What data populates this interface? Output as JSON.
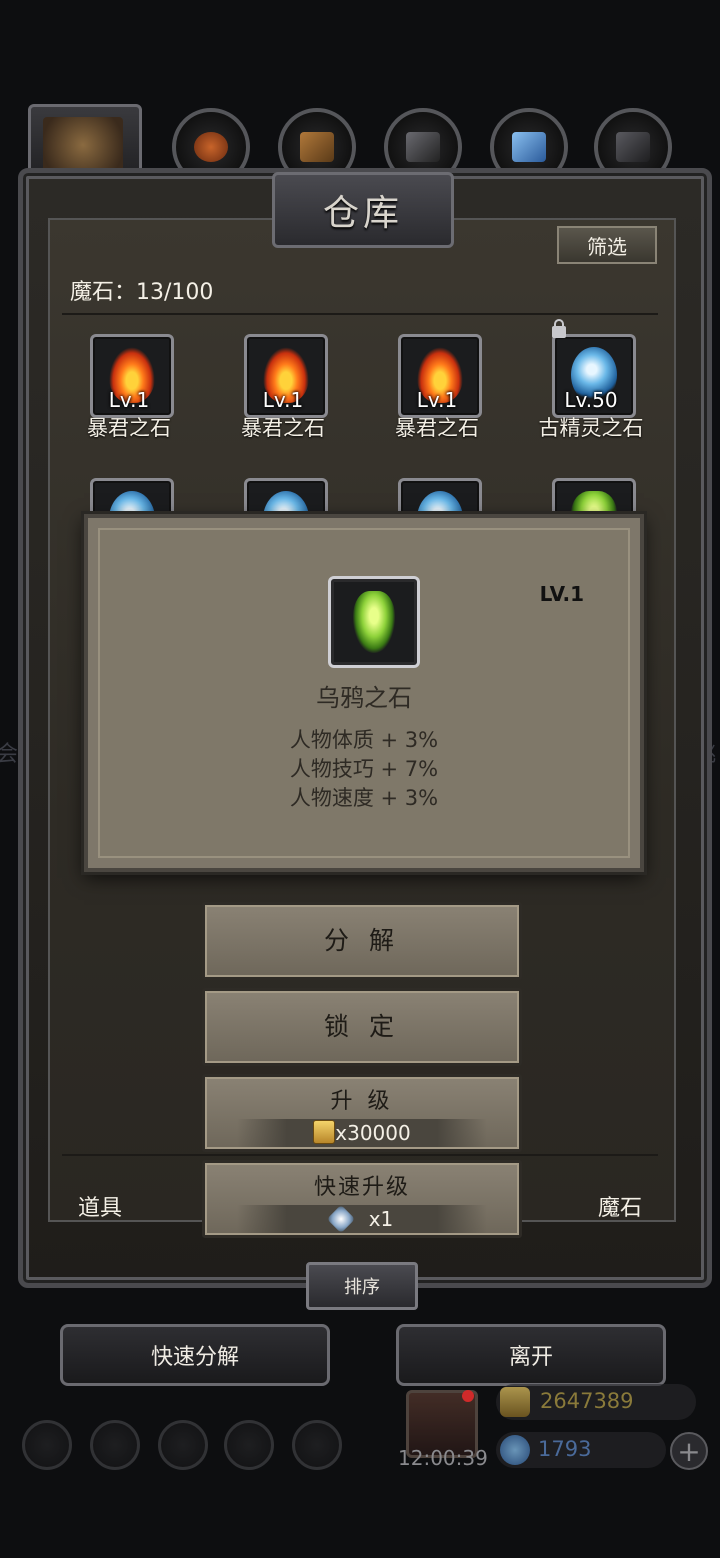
{
  "window": {
    "title": "仓库"
  },
  "toolbar": {
    "filter_label": "筛选"
  },
  "inventory": {
    "count_label": "魔石：13/100",
    "items": [
      {
        "level": "Lv.1",
        "name": "暴君之石",
        "icon": "fire-stone-icon"
      },
      {
        "level": "Lv.1",
        "name": "暴君之石",
        "icon": "fire-stone-icon"
      },
      {
        "level": "Lv.1",
        "name": "暴君之石",
        "icon": "fire-stone-icon"
      },
      {
        "level": "Lv.50",
        "name": "古精灵之石",
        "icon": "orb-stone-icon",
        "locked": true
      }
    ]
  },
  "detail": {
    "level": "LV.1",
    "name": "乌鸦之石",
    "icon": "green-crystal-icon",
    "stats": [
      "人物体质 + 3%",
      "人物技巧 + 7%",
      "人物速度 + 3%"
    ]
  },
  "actions": {
    "decompose": "分 解",
    "lock": "锁 定",
    "upgrade": "升 级",
    "upgrade_cost": "x30000",
    "quick_upgrade": "快速升级",
    "quick_upgrade_cost": "x1"
  },
  "tabs": {
    "items": "道具",
    "magic_stones": "魔石"
  },
  "sort_label": "排序",
  "footer": {
    "quick_decompose": "快速分解",
    "leave": "离开"
  },
  "hud": {
    "timer": "12:00:39",
    "gold": "2647389",
    "gems": "1793"
  },
  "colors": {
    "panel": "#7e776a",
    "button": "#8a8274",
    "frame": "#2c2a26"
  }
}
